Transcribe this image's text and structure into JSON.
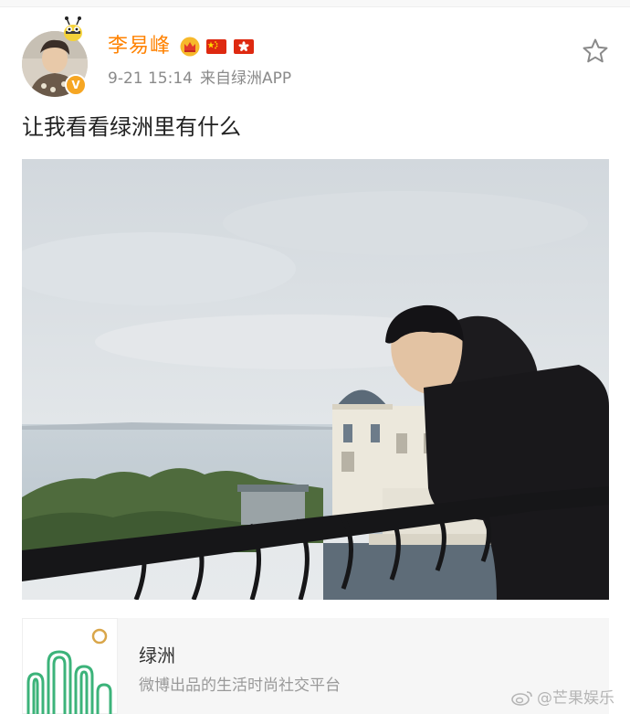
{
  "post": {
    "author": "李易峰",
    "time": "9-21 15:14",
    "source": "来自绿洲APP",
    "text": "让我看看绿洲里有什么",
    "verified_badge": "V"
  },
  "link_card": {
    "title": "绿洲",
    "subtitle": "微博出品的生活时尚社交平台"
  },
  "watermark": "@芒果娱乐",
  "icons": {
    "favorite": "star-outline-icon",
    "crown": "crown-icon",
    "flags": [
      "china-flag-icon",
      "hong-kong-flag-icon"
    ]
  },
  "colors": {
    "username": "#ff8200",
    "meta": "#8a8a8a",
    "card_bg": "#f6f6f6",
    "oasis_green": "#3cb37a"
  }
}
